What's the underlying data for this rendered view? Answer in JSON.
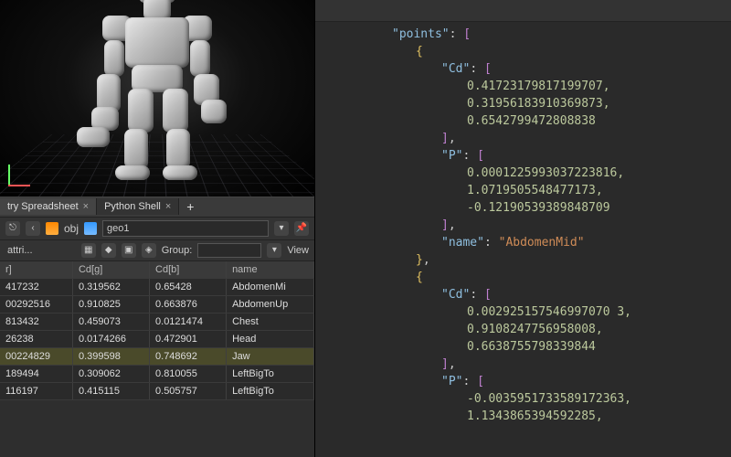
{
  "tabs": {
    "spreadsheet": "try Spreadsheet",
    "shell": "Python Shell"
  },
  "path": {
    "obj": "obj",
    "geo": "geo1"
  },
  "filter": {
    "attri": "attri...",
    "group": "Group:",
    "view": "View"
  },
  "columns": [
    "r]",
    "Cd[g]",
    "Cd[b]",
    "name"
  ],
  "rows": [
    {
      "r": "417232",
      "g": "0.319562",
      "b": "0.65428",
      "n": "AbdomenMi"
    },
    {
      "r": "00292516",
      "g": "0.910825",
      "b": "0.663876",
      "n": "AbdomenUp"
    },
    {
      "r": "813432",
      "g": "0.459073",
      "b": "0.0121474",
      "n": "Chest"
    },
    {
      "r": "26238",
      "g": "0.0174266",
      "b": "0.472901",
      "n": "Head"
    },
    {
      "r": "00224829",
      "g": "0.399598",
      "b": "0.748692",
      "n": "Jaw"
    },
    {
      "r": "189494",
      "g": "0.309062",
      "b": "0.810055",
      "n": "LeftBigTo"
    },
    {
      "r": "116197",
      "g": "0.415115",
      "b": "0.505757",
      "n": "LeftBigTo"
    }
  ],
  "chart_data": {
    "type": "table",
    "title": "points",
    "rows": [
      {
        "name": "AbdomenMid",
        "Cd": [
          0.41723179817199707,
          0.31956183910369873,
          0.6542799472808838
        ],
        "P": [
          0.0001225993037223816,
          1.0719505548477173,
          -0.12190539389848709
        ]
      },
      {
        "name": "",
        "Cd": [
          0.00292515754699707,
          0.9108247756958008,
          0.6638755798339844
        ],
        "P": [
          -0.0035951733589172363,
          1.1343865394592285
        ]
      }
    ]
  },
  "code": {
    "points_key": "\"points\"",
    "cd_key": "\"Cd\"",
    "p_key": "\"P\"",
    "name_key": "\"name\"",
    "name_val": "\"AbdomenMid\"",
    "cd1": [
      "0.41723179817199707,",
      "0.31956183910369873,",
      "0.6542799472808838"
    ],
    "p1": [
      "0.0001225993037223816,",
      "1.0719505548477173,",
      "-0.12190539389848709"
    ],
    "cd2": [
      "0.002925157546997070 3,",
      "0.9108247756958008,",
      "0.6638755798339844"
    ],
    "p2": [
      "-0.0035951733589172363,",
      "1.1343865394592285,"
    ]
  }
}
